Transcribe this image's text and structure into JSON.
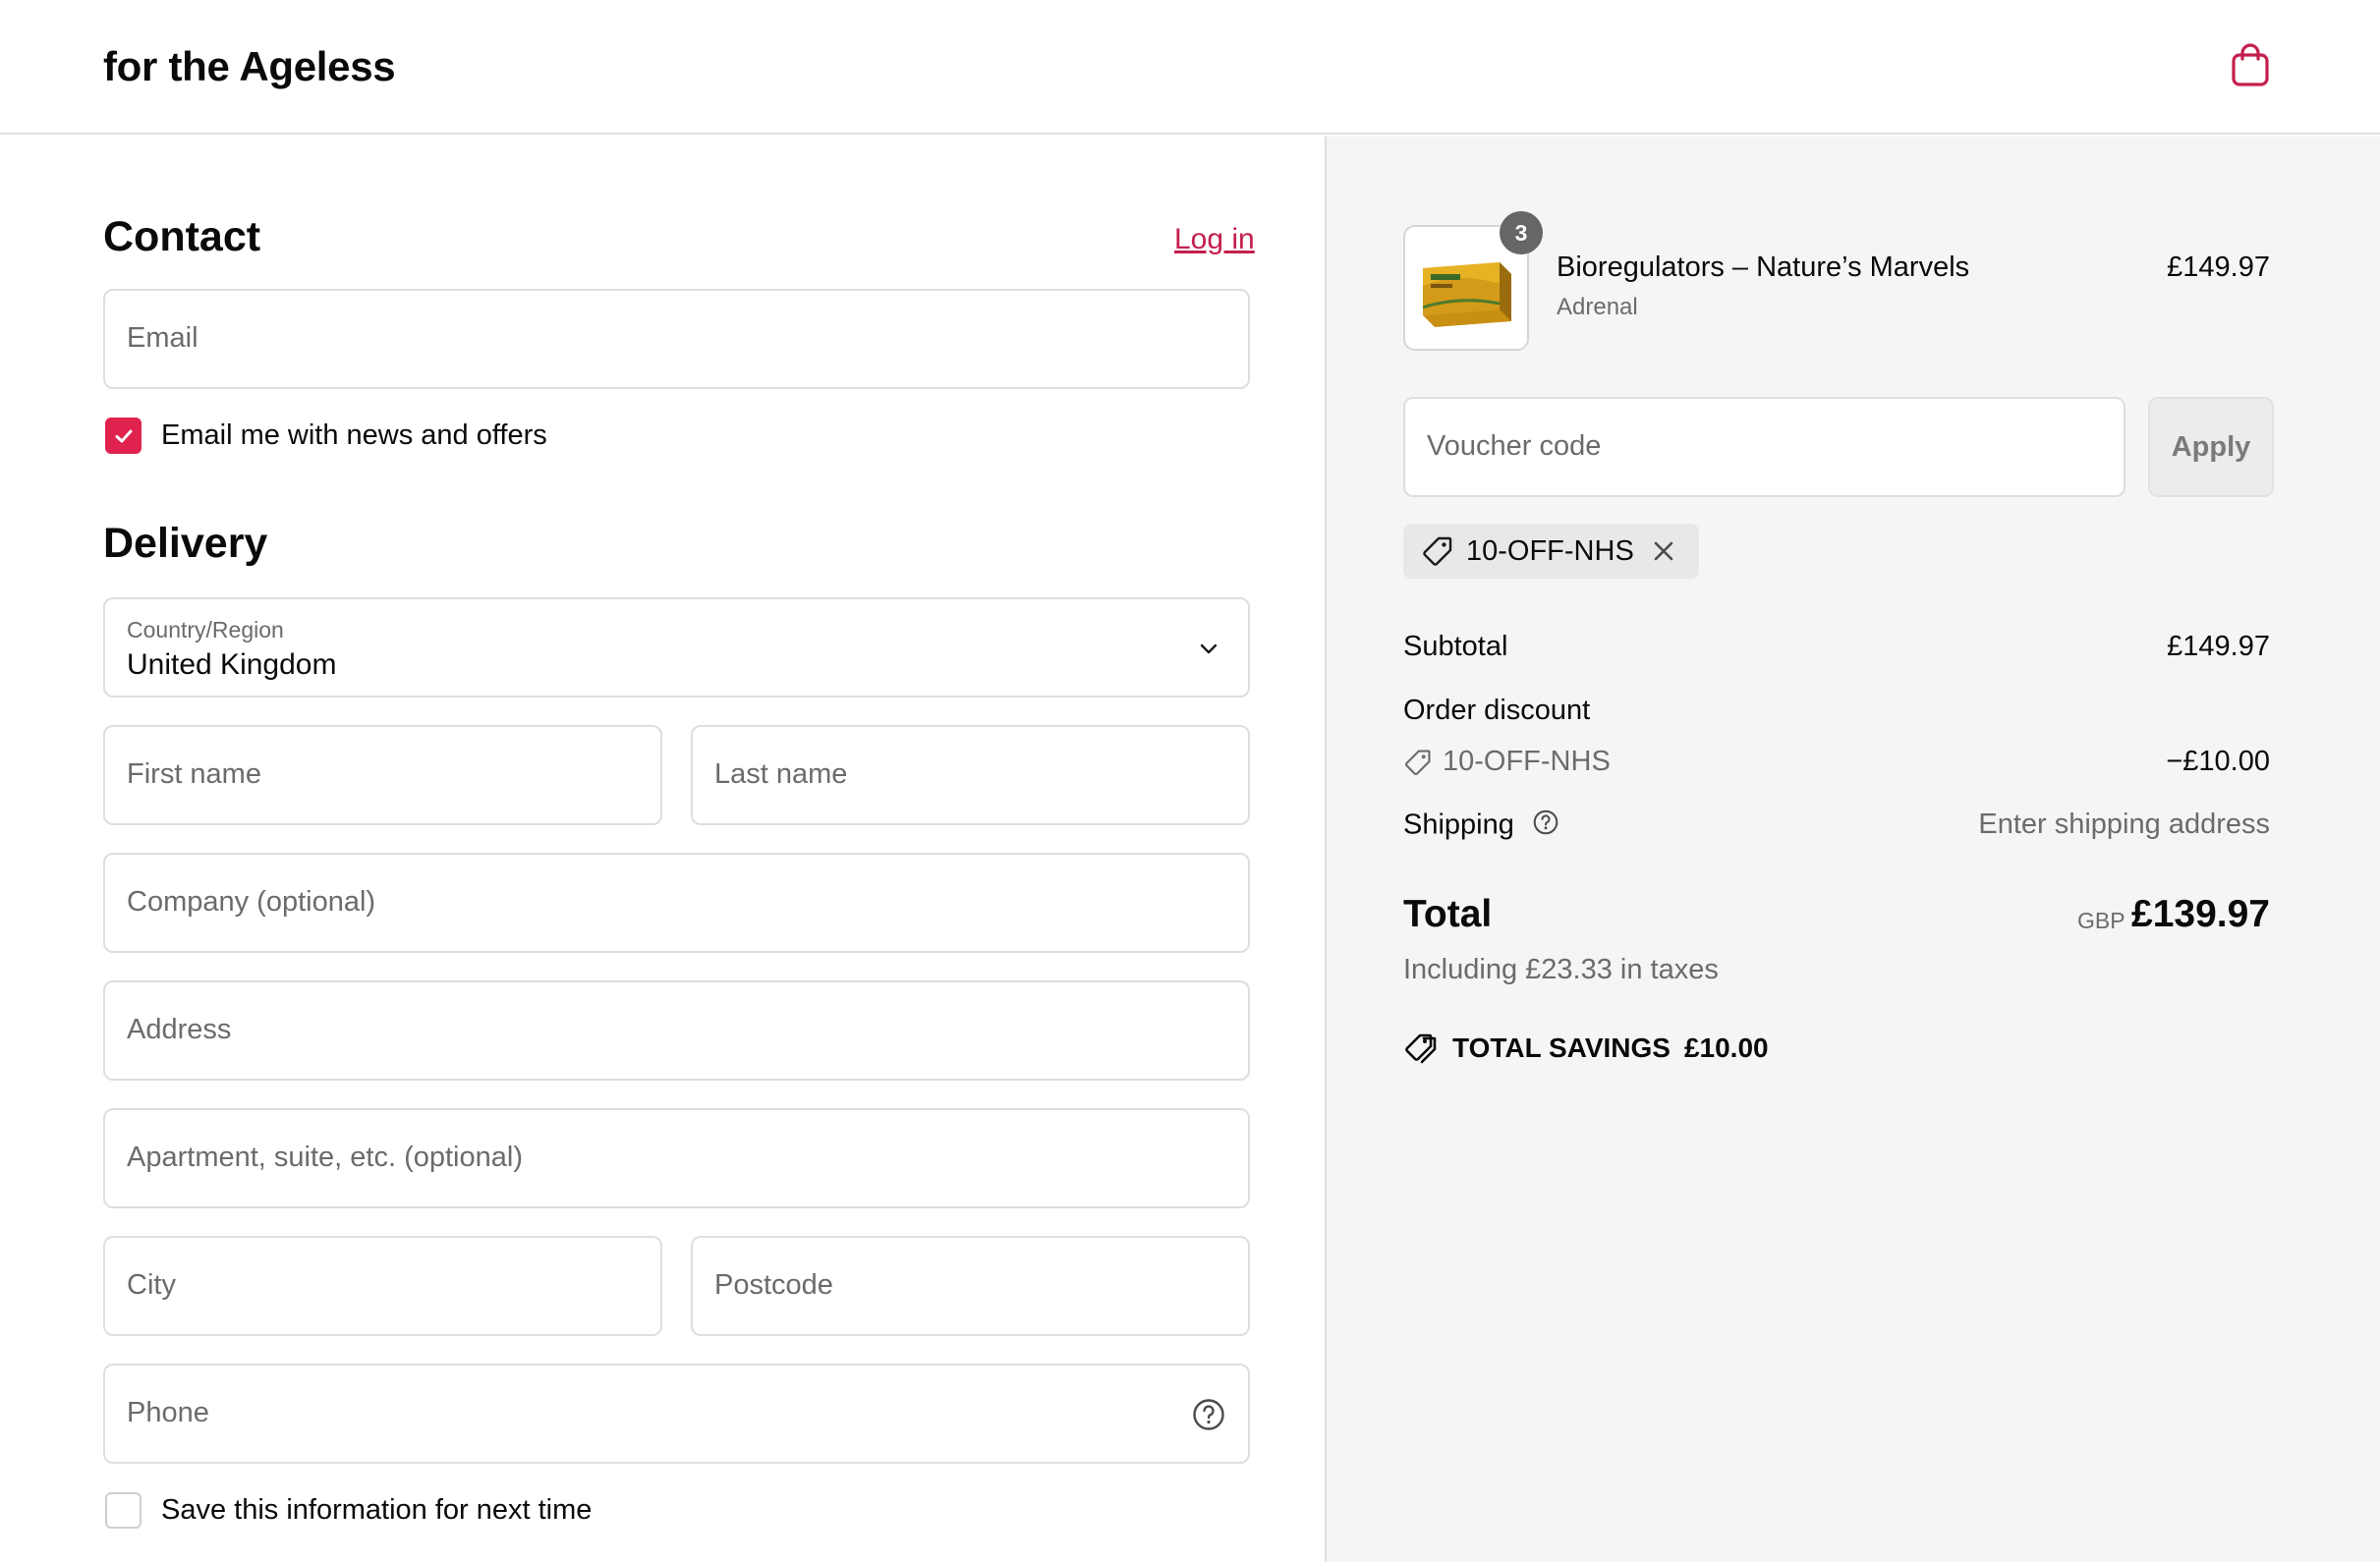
{
  "header": {
    "brand": "for the Ageless",
    "cart_icon": "shopping-bag-icon",
    "accent_color": "#c41f4d"
  },
  "contact": {
    "title": "Contact",
    "login_label": "Log in",
    "email_placeholder": "Email",
    "newsletter_label": "Email me with news and offers",
    "newsletter_checked": true
  },
  "delivery": {
    "title": "Delivery",
    "country_label": "Country/Region",
    "country_value": "United Kingdom",
    "first_name_placeholder": "First name",
    "last_name_placeholder": "Last name",
    "company_placeholder": "Company (optional)",
    "address_placeholder": "Address",
    "apartment_placeholder": "Apartment, suite, etc. (optional)",
    "city_placeholder": "City",
    "postcode_placeholder": "Postcode",
    "phone_placeholder": "Phone",
    "save_info_label": "Save this information for next time",
    "save_info_checked": false
  },
  "summary": {
    "item": {
      "quantity": "3",
      "name": "Bioregulators – Nature’s Marvels",
      "variant": "Adrenal",
      "price": "£149.97"
    },
    "voucher_placeholder": "Voucher code",
    "apply_label": "Apply",
    "applied_code": "10-OFF-NHS",
    "subtotal_label": "Subtotal",
    "subtotal_value": "£149.97",
    "order_discount_label": "Order discount",
    "discount_code": "10-OFF-NHS",
    "discount_value": "−£10.00",
    "shipping_label": "Shipping",
    "shipping_value": "Enter shipping address",
    "total_label": "Total",
    "currency": "GBP",
    "total_value": "£139.97",
    "tax_note": "Including £23.33 in taxes",
    "savings_label": "TOTAL SAVINGS",
    "savings_value": "£10.00"
  }
}
